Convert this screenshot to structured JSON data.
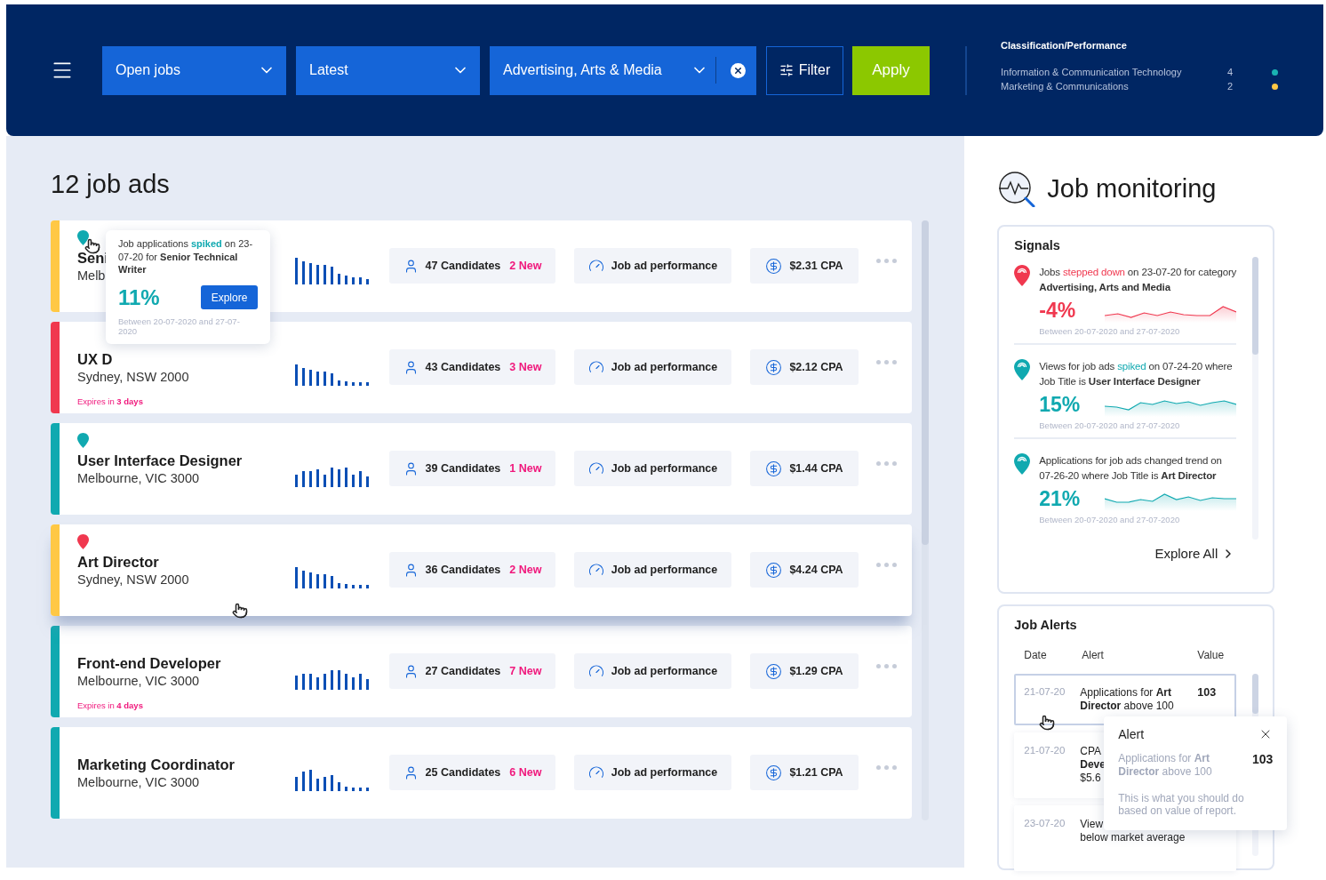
{
  "header": {
    "dropdowns": [
      {
        "label": "Open jobs",
        "clearable": false
      },
      {
        "label": "Latest",
        "clearable": false
      },
      {
        "label": "Advertising, Arts & Media",
        "clearable": true
      }
    ],
    "filter_button": "Filter",
    "apply_button": "Apply",
    "classification": {
      "title": "Classification/Performance",
      "rows": [
        {
          "name": "Information & Communication Technology",
          "count": "4",
          "color": "#1ab3b3"
        },
        {
          "name": "Marketing & Communications",
          "count": "2",
          "color": "#ffc845"
        }
      ]
    }
  },
  "job_ads": {
    "heading": "12 job ads",
    "jobs": [
      {
        "title": "Seni",
        "location": "Melb",
        "color": "#ffc845",
        "pin": {
          "color": "#10a9b0"
        },
        "candidates": "47 Candidates",
        "new": "2 New",
        "performance": "Job ad performance",
        "cpa": "$2.31 CPA",
        "raised": false
      },
      {
        "title": "UX D",
        "location": "Sydney, NSW 2000",
        "color": "#f0384f",
        "expires": "Expires in **3 days**",
        "candidates": "43 Candidates",
        "new": "3 New",
        "performance": "Job ad performance",
        "cpa": "$2.12 CPA",
        "raised": false
      },
      {
        "title": "User Interface Designer",
        "location": "Melbourne, VIC 3000",
        "color": "#10a9b0",
        "pin": {
          "color": "#10a9b0"
        },
        "candidates": "39 Candidates",
        "new": "1 New",
        "performance": "Job ad performance",
        "cpa": "$1.44 CPA",
        "raised": false
      },
      {
        "title": "Art Director",
        "location": "Sydney, NSW 2000",
        "color": "#ffc845",
        "pin": {
          "color": "#f0384f"
        },
        "candidates": "36 Candidates",
        "new": "2 New",
        "performance": "Job ad performance",
        "cpa": "$4.24 CPA",
        "raised": true
      },
      {
        "title": "Front-end Developer",
        "location": "Melbourne, VIC 3000",
        "color": "#10a9b0",
        "expires": "Expires in **4 days**",
        "candidates": "27 Candidates",
        "new": "7 New",
        "performance": "Job ad performance",
        "cpa": "$1.29 CPA",
        "raised": false
      },
      {
        "title": "Marketing Coordinator",
        "location": "Melbourne, VIC 3000",
        "color": "#10a9b0",
        "candidates": "25 Candidates",
        "new": "6 New",
        "performance": "Job ad performance",
        "cpa": "$1.21 CPA",
        "raised": false
      }
    ],
    "tooltip": {
      "text": "Job applications *spiked* on 23-07-20 for **Senior Technical Writer**",
      "value": "11%",
      "button": "Explore",
      "range": "Between 20-07-2020 and 27-07-2020"
    }
  },
  "monitoring": {
    "title": "Job monitoring",
    "signals": {
      "title": "Signals",
      "items": [
        {
          "text": "Jobs *stepped down* on 23-07-20 for category **Advertising, Arts and Media**",
          "value": "-4%",
          "color": "#f0384f",
          "range": "Between 20-07-2020 and 27-07-2020"
        },
        {
          "text": "Views for job ads *spiked* on 07-24-20 where Job Title is **User Interface Designer**",
          "value": "15%",
          "color": "#10a9b0",
          "range": "Between 20-07-2020 and 27-07-2020"
        },
        {
          "text": "Applications for job ads changed trend on 07-26-20 where Job Title is **Art Director**",
          "value": "21%",
          "color": "#10a9b0",
          "range": "Between 20-07-2020 and 27-07-2020"
        }
      ],
      "explore": "Explore All"
    },
    "alerts": {
      "title": "Job Alerts",
      "columns": [
        "Date",
        "Alert",
        "Value"
      ],
      "rows": [
        {
          "date": "21-07-20",
          "lines": [
            "Applications for **Art**",
            "**Director** above 100"
          ],
          "value": "103",
          "selected": true
        },
        {
          "date": "21-07-20",
          "lines": [
            "CPA",
            "**Deve**",
            "$5.6"
          ],
          "selected": false
        },
        {
          "date": "23-07-20",
          "lines": [
            "View",
            "below market average"
          ],
          "selected": false
        }
      ],
      "popup": {
        "title": "Alert",
        "text": "Applications for **Art Director** above 100",
        "value": "103",
        "note": "This is what you should do based on value of report."
      }
    }
  }
}
